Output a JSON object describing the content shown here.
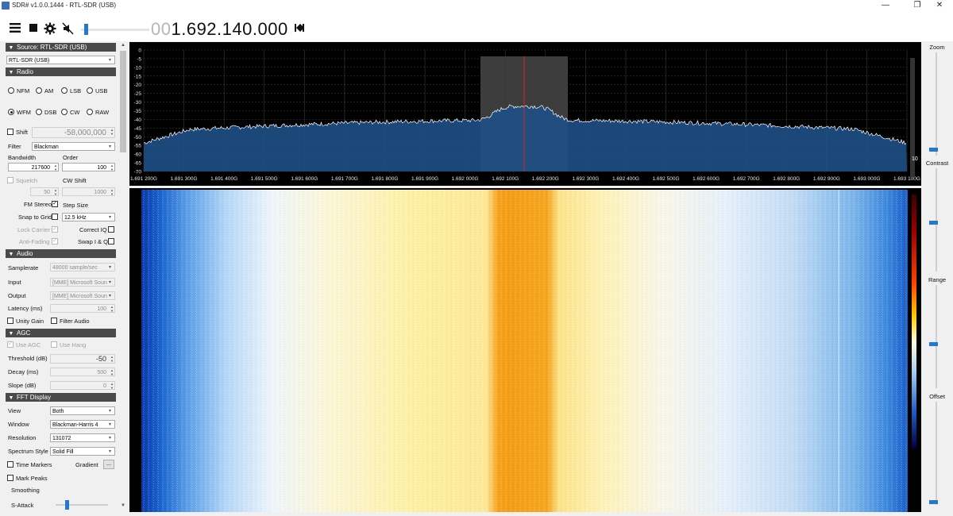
{
  "window": {
    "title": "SDR# v1.0.0.1444 - RTL-SDR (USB)",
    "minimize": "—",
    "maximize": "❐",
    "close": "✕"
  },
  "toolbar": {
    "menu_icon": "hamburger-menu-icon",
    "stop_icon": "stop-icon",
    "settings_icon": "gear-icon",
    "mute_icon": "muted-speaker-icon",
    "volume": 0.05,
    "frequency_prefix": "00",
    "frequency_main": "1.692.140.000",
    "tune_icon": "skip-icon"
  },
  "source": {
    "header": "Source: RTL-SDR (USB)",
    "device": "RTL-SDR (USB)"
  },
  "radio": {
    "header": "Radio",
    "modes_row1": [
      "NFM",
      "AM",
      "LSB",
      "USB"
    ],
    "modes_row2": [
      "WFM",
      "DSB",
      "CW",
      "RAW"
    ],
    "selected_mode": "WFM",
    "shift_label": "Shift",
    "shift_value": "-58,000,000",
    "filter_label": "Filter",
    "filter_value": "Blackman",
    "bandwidth_label": "Bandwidth",
    "bandwidth_value": "217600",
    "order_label": "Order",
    "order_value": "100",
    "squelch_label": "Squelch",
    "squelch_value": "50",
    "cwshift_label": "CW Shift",
    "cwshift_value": "1000",
    "fm_stereo_label": "FM Stereo",
    "step_size_label": "Step Size",
    "snap_label": "Snap to Grid",
    "step_value": "12.5 kHz",
    "lock_carrier_label": "Lock Carrier",
    "correct_iq_label": "Correct IQ",
    "anti_fading_label": "Anti-Fading",
    "swap_iq_label": "Swap I & Q"
  },
  "audio": {
    "header": "Audio",
    "samplerate_label": "Samplerate",
    "samplerate_value": "48000 sample/sec",
    "input_label": "Input",
    "input_value": "[MME] Microsoft Soun",
    "output_label": "Output",
    "output_value": "[MME] Microsoft Soun",
    "latency_label": "Latency (ms)",
    "latency_value": "100",
    "unity_gain_label": "Unity Gain",
    "filter_audio_label": "Filter Audio"
  },
  "agc": {
    "header": "AGC",
    "use_agc_label": "Use AGC",
    "use_hang_label": "Use Hang",
    "threshold_label": "Threshold (dB)",
    "threshold_value": "-50",
    "decay_label": "Decay (ms)",
    "decay_value": "500",
    "slope_label": "Slope (dB)",
    "slope_value": "0"
  },
  "fft": {
    "header": "FFT Display",
    "view_label": "View",
    "view_value": "Both",
    "window_label": "Window",
    "window_value": "Blackman-Harris 4",
    "resolution_label": "Resolution",
    "resolution_value": "131072",
    "style_label": "Spectrum Style",
    "style_value": "Solid Fill",
    "time_markers_label": "Time Markers",
    "gradient_label": "Gradient",
    "gradient_button": "...",
    "mark_peaks_label": "Mark Peaks",
    "smoothing_label": "Smoothing",
    "sattack_label": "S-Attack"
  },
  "spectrum": {
    "y_ticks": [
      "0",
      "-5",
      "-10",
      "-15",
      "-20",
      "-25",
      "-30",
      "-35",
      "-40",
      "-45",
      "-50",
      "-55",
      "-60",
      "-65",
      "-70"
    ],
    "x_ticks": [
      "1.691 200G",
      "1.691 300G",
      "1.691 400G",
      "1.691 500G",
      "1.691 600G",
      "1.691 700G",
      "1.691 800G",
      "1.691 900G",
      "1.692 000G",
      "1.692 100G",
      "1.692 200G",
      "1.692 300G",
      "1.692 400G",
      "1.692 500G",
      "1.692 600G",
      "1.692 700G",
      "1.692 800G",
      "1.692 900G",
      "1.693 000G",
      "1.693 100G"
    ],
    "level_indicator": "10",
    "colors": {
      "fill": "#1e4f86",
      "trace": "#ffffff",
      "cursor": "#e02020",
      "grid": "#3a3a3a"
    }
  },
  "right_panel": {
    "zoom_label": "Zoom",
    "contrast_label": "Contrast",
    "range_label": "Range",
    "offset_label": "Offset",
    "thumb_color": "#2478d0"
  }
}
